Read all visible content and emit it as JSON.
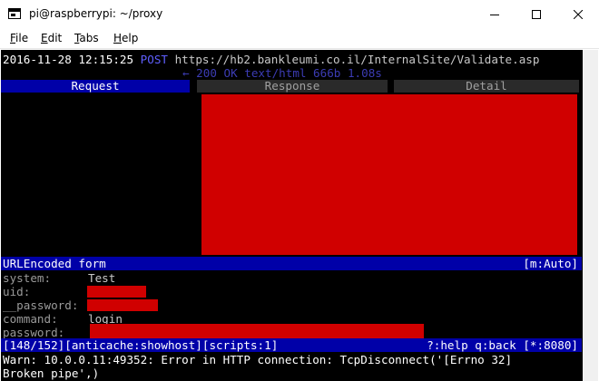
{
  "window": {
    "title": "pi@raspberrypi: ~/proxy",
    "controls": [
      "minimize-icon",
      "maximize-icon",
      "close-icon"
    ]
  },
  "menu": {
    "items": [
      {
        "pre": "",
        "key": "F",
        "post": "ile"
      },
      {
        "pre": "",
        "key": "E",
        "post": "dit"
      },
      {
        "pre": "",
        "key": "T",
        "post": "abs"
      },
      {
        "pre": "",
        "key": "H",
        "post": "elp"
      }
    ]
  },
  "flow": {
    "timestamp": "2016-11-28 12:15:25",
    "method": "POST",
    "url": "https://hb2.bankleumi.co.il/InternalSite/Validate.asp",
    "response": "← 200 OK text/html 666b 1.08s"
  },
  "tabs": [
    {
      "label": "Request",
      "active": true
    },
    {
      "label": "Response",
      "active": false
    },
    {
      "label": "Detail",
      "active": false
    }
  ],
  "form": {
    "header": "URLEncoded form",
    "mode": "[m:Auto]",
    "fields": [
      {
        "label": "system:",
        "value": "Test",
        "redacted": false
      },
      {
        "label": "uid:",
        "value": "",
        "redacted": true
      },
      {
        "label": "__password:",
        "value": "",
        "redacted": true
      },
      {
        "label": "command:",
        "value": "login",
        "redacted": false
      },
      {
        "label": "password:",
        "value": "",
        "redacted": true
      }
    ]
  },
  "statusbar": {
    "left": "[148/152][anticache:showhost][scripts:1]",
    "right": "?:help q:back [*:8080]"
  },
  "warning": {
    "line1": "Warn: 10.0.0.11:49352: Error in HTTP connection: TcpDisconnect('[Errno 32]",
    "line2": "Broken pipe',)"
  },
  "colors": {
    "terminal_bg": "#000000",
    "bar_blue": "#0000a8",
    "redaction_red": "#d00000",
    "method_blue": "#5f5fff"
  }
}
